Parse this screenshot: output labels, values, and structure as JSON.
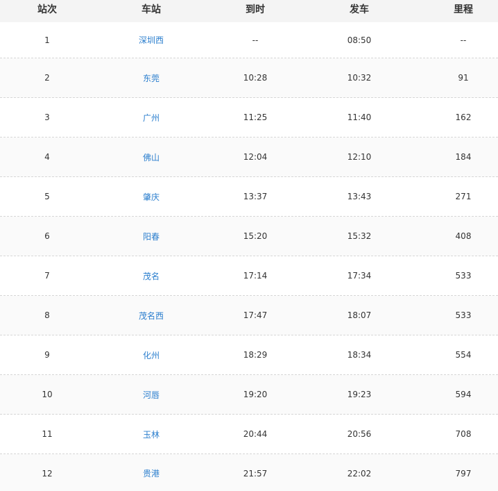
{
  "table": {
    "headers": [
      "站次",
      "车站",
      "到时",
      "发车",
      "里程"
    ],
    "rows": [
      {
        "no": "1",
        "station": "深圳西",
        "arrive": "--",
        "depart": "08:50",
        "distance": "--"
      },
      {
        "no": "2",
        "station": "东莞",
        "arrive": "10:28",
        "depart": "10:32",
        "distance": "91"
      },
      {
        "no": "3",
        "station": "广州",
        "arrive": "11:25",
        "depart": "11:40",
        "distance": "162"
      },
      {
        "no": "4",
        "station": "佛山",
        "arrive": "12:04",
        "depart": "12:10",
        "distance": "184"
      },
      {
        "no": "5",
        "station": "肇庆",
        "arrive": "13:37",
        "depart": "13:43",
        "distance": "271"
      },
      {
        "no": "6",
        "station": "阳春",
        "arrive": "15:20",
        "depart": "15:32",
        "distance": "408"
      },
      {
        "no": "7",
        "station": "茂名",
        "arrive": "17:14",
        "depart": "17:34",
        "distance": "533"
      },
      {
        "no": "8",
        "station": "茂名西",
        "arrive": "17:47",
        "depart": "18:07",
        "distance": "533"
      },
      {
        "no": "9",
        "station": "化州",
        "arrive": "18:29",
        "depart": "18:34",
        "distance": "554"
      },
      {
        "no": "10",
        "station": "河唇",
        "arrive": "19:20",
        "depart": "19:23",
        "distance": "594"
      },
      {
        "no": "11",
        "station": "玉林",
        "arrive": "20:44",
        "depart": "20:56",
        "distance": "708"
      },
      {
        "no": "12",
        "station": "贵港",
        "arrive": "21:57",
        "depart": "22:02",
        "distance": "797"
      }
    ]
  },
  "colors": {
    "header_bg": "#f4f4f4",
    "station_link": "#2c7fce",
    "text": "#333333",
    "row_divider": "#d6d6d6"
  }
}
